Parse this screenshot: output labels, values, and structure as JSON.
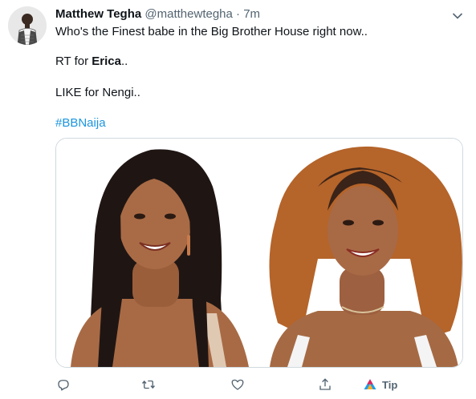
{
  "tweet": {
    "author_name": "Matthew Tegha",
    "handle": "@matthewtegha",
    "separator": "·",
    "time": "7m",
    "line1": "Who's the Finest babe in the Big Brother House right now..",
    "line2_prefix": "RT for ",
    "line2_bold": "Erica",
    "line2_suffix": "..",
    "line3": "LIKE for Nengi..",
    "hashtag": "#BBNaija"
  },
  "actions": {
    "tip_label": "Tip"
  },
  "colors": {
    "link": "#1b95e0",
    "secondary_text": "#536471",
    "border": "#cfd9de"
  },
  "icons": [
    "user-avatar",
    "chevron-down-icon",
    "reply-icon",
    "retweet-icon",
    "like-icon",
    "share-icon",
    "tip-icon"
  ]
}
